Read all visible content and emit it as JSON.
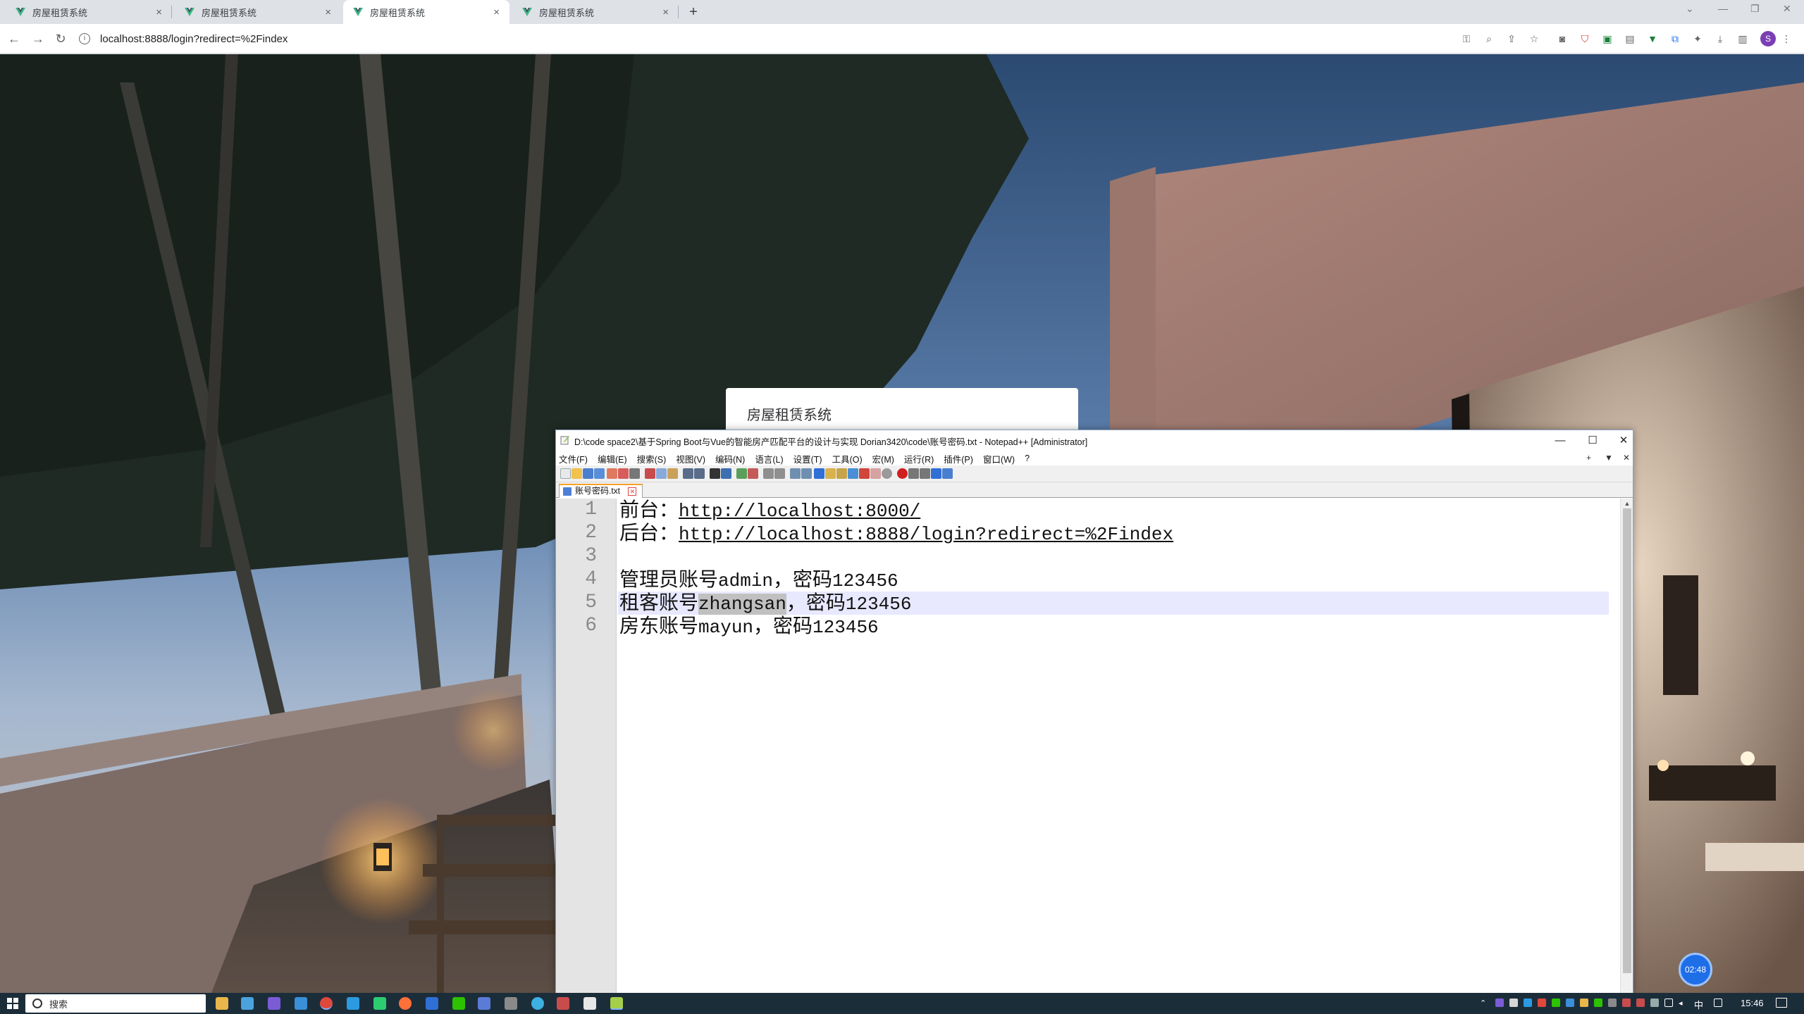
{
  "browser": {
    "tabs": [
      {
        "title": "房屋租赁系统",
        "active": false
      },
      {
        "title": "房屋租赁系统",
        "active": false
      },
      {
        "title": "房屋租赁系统",
        "active": true
      },
      {
        "title": "房屋租赁系统",
        "active": false
      }
    ],
    "url": "localhost:8888/login?redirect=%2Findex",
    "profile_initial": "S",
    "close_glyph": "×",
    "new_tab_glyph": "+"
  },
  "page": {
    "login_title": "房屋租赁系统",
    "timer": "02:48"
  },
  "notepad": {
    "title": "D:\\code space2\\基于Spring Boot与Vue的智能房产匹配平台的设计与实现 Dorian3420\\code\\账号密码.txt - Notepad++ [Administrator]",
    "menu": [
      "文件(F)",
      "编辑(E)",
      "搜索(S)",
      "视图(V)",
      "编码(N)",
      "语言(L)",
      "设置(T)",
      "工具(O)",
      "宏(M)",
      "运行(R)",
      "插件(P)",
      "窗口(W)",
      "?"
    ],
    "menu_right": [
      "+",
      "▼",
      "✕"
    ],
    "tab": "账号密码.txt",
    "lines": [
      {
        "num": "1",
        "prefix": "前台：",
        "url": "http://localhost:8000/"
      },
      {
        "num": "2",
        "prefix": "后台：",
        "url": "http://localhost:8888/login?redirect=%2Findex"
      },
      {
        "num": "3",
        "text": ""
      },
      {
        "num": "4",
        "a": "管理员账号",
        "b": "admin",
        "c": "，密码",
        "d": "123456"
      },
      {
        "num": "5",
        "a": "租客账号",
        "b": "zhangsan",
        "c": "，密码",
        "d": "123456"
      },
      {
        "num": "6",
        "a": "房东账号",
        "b": "mayun",
        "c": "，密码",
        "d": "123456"
      }
    ]
  },
  "taskbar": {
    "search_placeholder": "搜索",
    "ime": "中",
    "clock": "15:46"
  },
  "colors": {
    "accent_tab_top": "#f7a027",
    "current_line": "#e8e8ff",
    "selection": "#c0c0c0",
    "taskbar": "#1c2d3a"
  }
}
